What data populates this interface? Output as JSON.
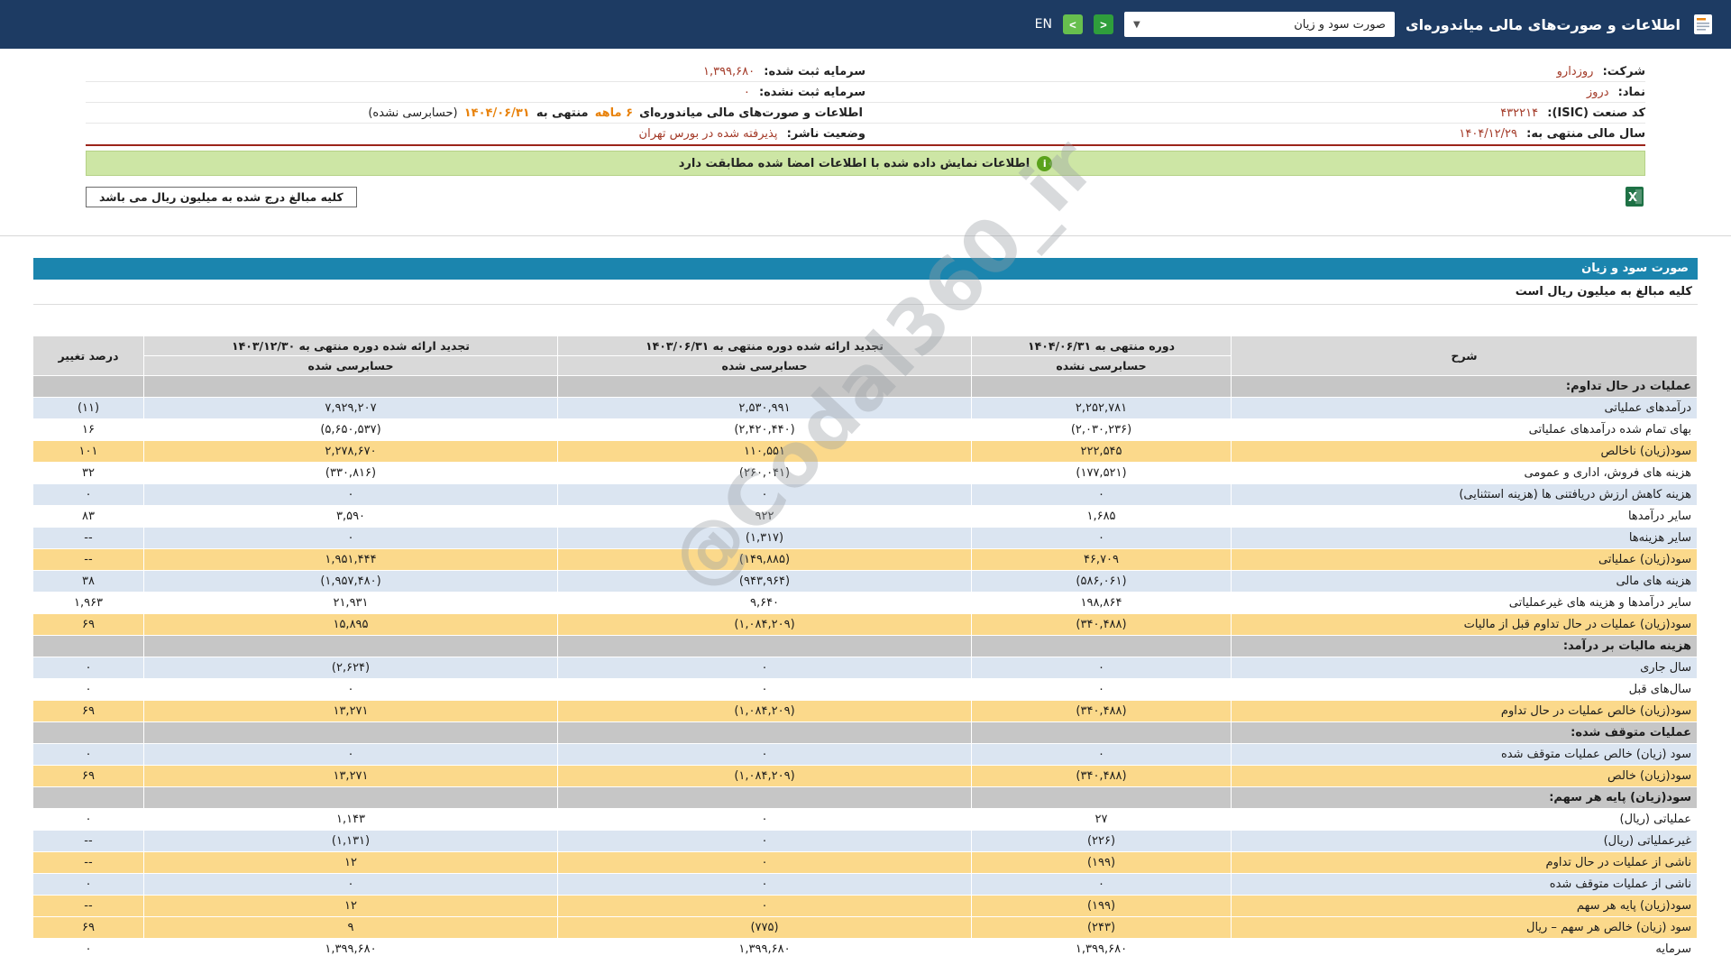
{
  "colors": {
    "topbar_bg": "#1d3b63",
    "statement_title_bg": "#1b85ae",
    "row_blue": "#dbe5f1",
    "row_yellow": "#fbd98b",
    "section_gray": "#c6c6c6",
    "negative_red": "#d21f1b",
    "info_value_maroon": "#a33a28",
    "highlight_orange": "#e8820c",
    "signature_bar_green": "#cde6a5"
  },
  "topbar": {
    "lang_label": "EN",
    "title": "اطلاعات و صورت‌های مالی میاندوره‌ای",
    "statement_select": {
      "value": "صورت سود و زیان",
      "caret": "▼"
    },
    "next_label": ">",
    "prev_label": "<"
  },
  "company": {
    "rows": [
      {
        "r_label": "شرکت:",
        "r_value": "روزدارو",
        "l_label": "سرمایه ثبت شده:",
        "l_value": "۱,۳۹۹,۶۸۰"
      },
      {
        "r_label": "نماد:",
        "r_value": "دروز",
        "l_label": "سرمایه ثبت نشده:",
        "l_value": "۰"
      },
      {
        "r_label": "کد صنعت (ISIC):",
        "r_value": "۴۳۲۲۱۴"
      },
      {
        "r_label": "سال مالی منتهی به:",
        "r_value": "۱۴۰۴/۱۲/۲۹",
        "l_label": "وضعیت ناشر:",
        "l_value": "پذیرفته شده در بورس تهران"
      }
    ],
    "report_line": {
      "prefix": "اطلاعات و صورت‌های مالی میاندوره‌ای",
      "period": "۶ ماهه",
      "middle": "منتهی به",
      "date": "۱۴۰۴/۰۶/۳۱",
      "suffix": "(حسابرسی نشده)"
    }
  },
  "messages": {
    "signature_match": "اطلاعات نمایش داده شده با اطلاعات امضا شده مطابقت دارد",
    "signature_icon": "i",
    "units_box": "کلیه مبالغ درج شده به میلیون ریال می باشد"
  },
  "statement": {
    "title": "صورت سود و زیان",
    "units_note": "کلیه مبالغ به میلیون ریال است",
    "watermark": "@Codal360_ir",
    "table": {
      "headers": {
        "desc": "شرح",
        "col1_title": "دوره منتهی به ۱۴۰۴/۰۶/۳۱",
        "col1_sub": "حسابرسی نشده",
        "col2_title": "تجدید ارائه شده دوره منتهی به ۱۴۰۳/۰۶/۳۱",
        "col2_sub": "حسابرسی شده",
        "col3_title": "تجدید ارائه شده دوره منتهی به ۱۴۰۳/۱۲/۳۰",
        "col3_sub": "حسابرسی شده",
        "change": "درصد تغییر"
      },
      "rows": [
        {
          "type": "section",
          "desc": "عملیات در حال تداوم:"
        },
        {
          "type": "data",
          "style": "blue",
          "desc": "درآمدهای عملیاتی",
          "v1": "۲,۲۵۲,۷۸۱",
          "v2": "۲,۵۳۰,۹۹۱",
          "v3": "۷,۹۲۹,۲۰۷",
          "chg": "(۱۱)"
        },
        {
          "type": "data",
          "style": "white",
          "desc": "بهای تمام شده درآمدهای عملیاتی",
          "v1": "(۲,۰۳۰,۲۳۶)",
          "v2": "(۲,۴۲۰,۴۴۰)",
          "v3": "(۵,۶۵۰,۵۳۷)",
          "chg": "۱۶"
        },
        {
          "type": "data",
          "style": "yellow",
          "desc": "سود(زیان) ناخالص",
          "v1": "۲۲۲,۵۴۵",
          "v2": "۱۱۰,۵۵۱",
          "v3": "۲,۲۷۸,۶۷۰",
          "chg": "۱۰۱"
        },
        {
          "type": "data",
          "style": "white",
          "desc": "هزینه های فروش، اداری و عمومی",
          "v1": "(۱۷۷,۵۲۱)",
          "v2": "(۲۶۰,۰۴۱)",
          "v3": "(۳۳۰,۸۱۶)",
          "chg": "۳۲"
        },
        {
          "type": "data",
          "style": "blue",
          "desc": "هزینه کاهش ارزش دریافتنی ها (هزینه استثنایی)",
          "v1": "۰",
          "v2": "۰",
          "v3": "۰",
          "chg": "۰"
        },
        {
          "type": "data",
          "style": "white",
          "desc": "سایر درآمدها",
          "v1": "۱,۶۸۵",
          "v2": "۹۲۲",
          "v3": "۳,۵۹۰",
          "chg": "۸۳"
        },
        {
          "type": "data",
          "style": "blue",
          "desc": "سایر هزینه‌ها",
          "v1": "۰",
          "v2": "(۱,۳۱۷)",
          "v3": "۰",
          "chg": "--"
        },
        {
          "type": "data",
          "style": "yellow",
          "desc": "سود(زیان) عملیاتی",
          "v1": "۴۶,۷۰۹",
          "v2": "(۱۴۹,۸۸۵)",
          "v3": "۱,۹۵۱,۴۴۴",
          "chg": "--"
        },
        {
          "type": "data",
          "style": "blue",
          "desc": "هزینه های مالی",
          "v1": "(۵۸۶,۰۶۱)",
          "v2": "(۹۴۳,۹۶۴)",
          "v3": "(۱,۹۵۷,۴۸۰)",
          "chg": "۳۸"
        },
        {
          "type": "data",
          "style": "white",
          "desc": "سایر درآمدها و هزینه های غیرعملیاتی",
          "v1": "۱۹۸,۸۶۴",
          "v2": "۹,۶۴۰",
          "v3": "۲۱,۹۳۱",
          "chg": "۱,۹۶۳"
        },
        {
          "type": "data",
          "style": "yellow",
          "desc": "سود(زیان) عملیات در حال تداوم قبل از مالیات",
          "v1": "(۳۴۰,۴۸۸)",
          "v2": "(۱,۰۸۴,۲۰۹)",
          "v3": "۱۵,۸۹۵",
          "chg": "۶۹"
        },
        {
          "type": "section",
          "desc": "هزینه مالیات بر درآمد:"
        },
        {
          "type": "data",
          "style": "blue",
          "desc": "سال جاری",
          "v1": "۰",
          "v2": "۰",
          "v3": "(۲,۶۲۴)",
          "chg": "۰"
        },
        {
          "type": "data",
          "style": "white",
          "desc": "سال‌های قبل",
          "v1": "۰",
          "v2": "۰",
          "v3": "۰",
          "chg": "۰"
        },
        {
          "type": "data",
          "style": "yellow",
          "desc": "سود(زیان) خالص عملیات در حال تداوم",
          "v1": "(۳۴۰,۴۸۸)",
          "v2": "(۱,۰۸۴,۲۰۹)",
          "v3": "۱۳,۲۷۱",
          "chg": "۶۹"
        },
        {
          "type": "section",
          "desc": "عملیات متوقف شده:"
        },
        {
          "type": "data",
          "style": "blue",
          "desc": "سود (زیان) خالص عملیات متوقف شده",
          "v1": "۰",
          "v2": "۰",
          "v3": "۰",
          "chg": "۰"
        },
        {
          "type": "data",
          "style": "yellow",
          "desc": "سود(زیان) خالص",
          "v1": "(۳۴۰,۴۸۸)",
          "v2": "(۱,۰۸۴,۲۰۹)",
          "v3": "۱۳,۲۷۱",
          "chg": "۶۹"
        },
        {
          "type": "section",
          "desc": "سود(زیان) پایه هر سهم:"
        },
        {
          "type": "data",
          "style": "white",
          "desc": "عملیاتی (ریال)",
          "v1": "۲۷",
          "v2": "۰",
          "v3": "۱,۱۴۳",
          "chg": "۰"
        },
        {
          "type": "data",
          "style": "blue",
          "desc": "غیرعملیاتی (ریال)",
          "v1": "(۲۲۶)",
          "v2": "۰",
          "v3": "(۱,۱۳۱)",
          "chg": "--"
        },
        {
          "type": "data",
          "style": "yellow",
          "desc": "ناشی از عملیات در حال تداوم",
          "v1": "(۱۹۹)",
          "v2": "۰",
          "v3": "۱۲",
          "chg": "--"
        },
        {
          "type": "data",
          "style": "blue",
          "desc": "ناشی از عملیات متوقف شده",
          "v1": "۰",
          "v2": "۰",
          "v3": "۰",
          "chg": "۰"
        },
        {
          "type": "data",
          "style": "yellow",
          "desc": "سود(زیان) پایه هر سهم",
          "v1": "(۱۹۹)",
          "v2": "۰",
          "v3": "۱۲",
          "chg": "--"
        },
        {
          "type": "data",
          "style": "yellow",
          "desc": "سود (زیان) خالص هر سهم – ریال",
          "v1": "(۲۴۳)",
          "v2": "(۷۷۵)",
          "v3": "۹",
          "chg": "۶۹"
        },
        {
          "type": "data",
          "style": "white",
          "desc": "سرمایه",
          "v1": "۱,۳۹۹,۶۸۰",
          "v2": "۱,۳۹۹,۶۸۰",
          "v3": "۱,۳۹۹,۶۸۰",
          "chg": "۰"
        }
      ]
    }
  }
}
